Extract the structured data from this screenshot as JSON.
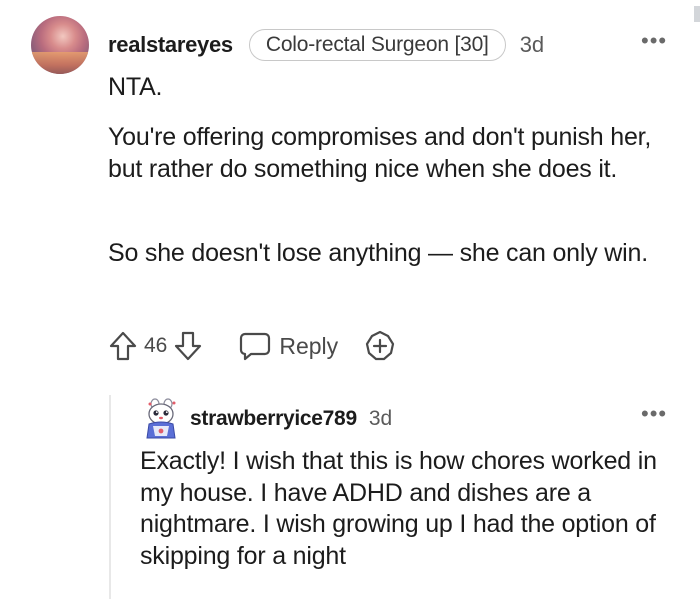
{
  "comment": {
    "username": "realstareyes",
    "flair": "Colo-rectal Surgeon [30]",
    "timestamp": "3d",
    "more_icon": "more-horizontal-icon",
    "paragraphs": [
      "NTA.",
      "You're offering compromises and don't punish her, but rather do something nice when she does it.",
      "So she doesn't lose anything — she can only win."
    ],
    "vote_count": "46",
    "reply_label": "Reply",
    "icons": {
      "upvote": "arrow-up-icon",
      "downvote": "arrow-down-icon",
      "reply": "speech-bubble-icon",
      "award": "award-plus-icon"
    }
  },
  "reply": {
    "username": "strawberryice789",
    "timestamp": "3d",
    "more_icon": "more-horizontal-icon",
    "text": "Exactly! I wish that this is how chores worked in my house. I have ADHD and dishes are a nightmare. I wish growing up I had the option of skipping for a night"
  },
  "colors": {
    "text": "#1c1c1c",
    "meta": "#5a5a5a",
    "icon": "#4a4a4a",
    "flair_border": "#c8c8c8",
    "thread_line": "#e8e8e8"
  }
}
